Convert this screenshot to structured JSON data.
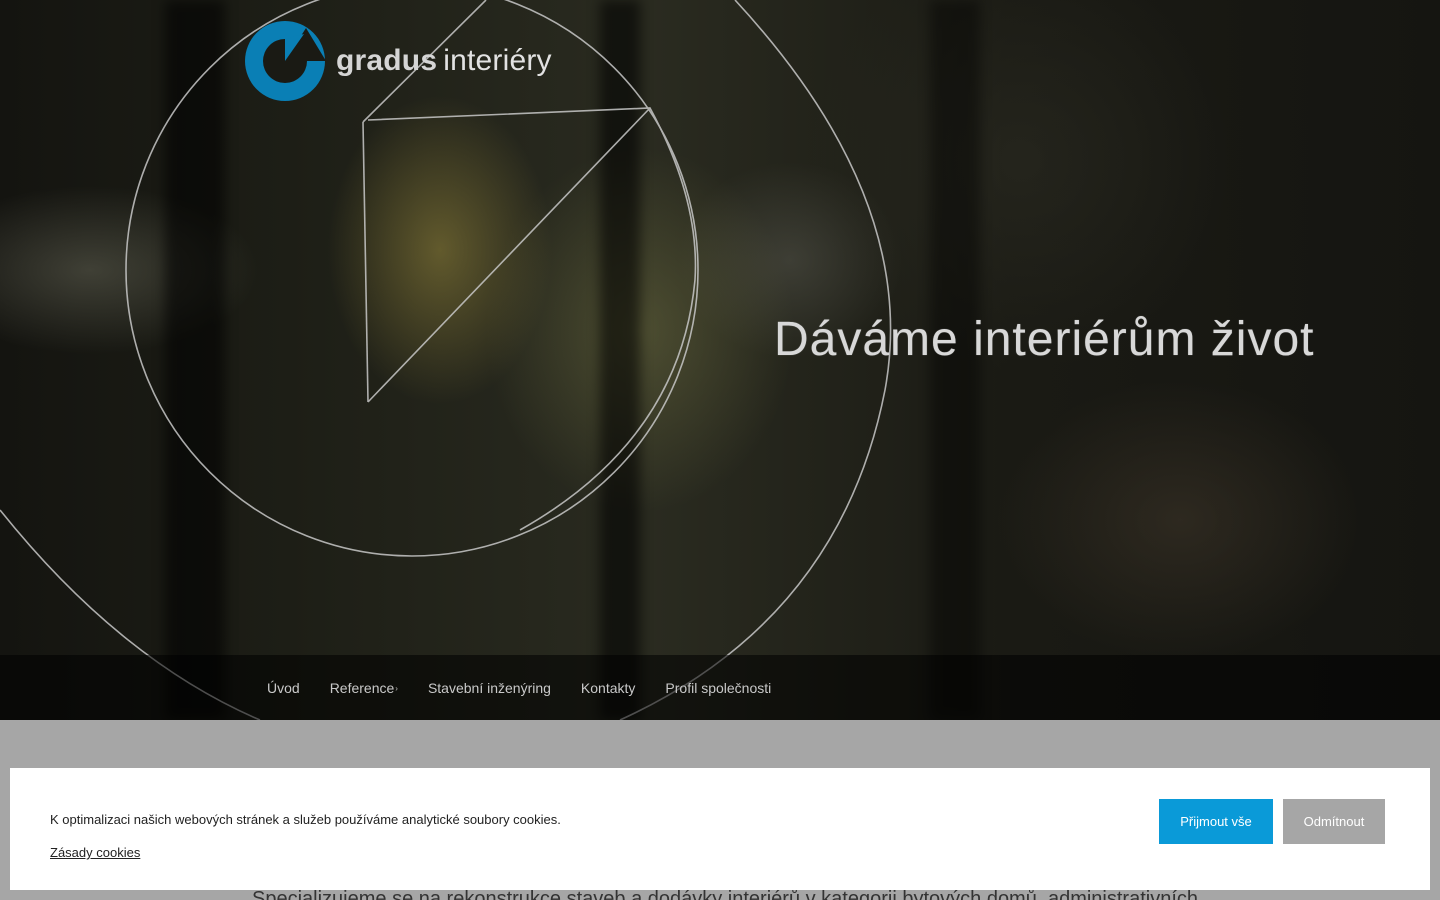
{
  "brand": {
    "name_bold": "gradus",
    "name_light": "interiéry",
    "mark_color": "#0a7fb5",
    "mark_icon": "gradus-logo-icon"
  },
  "hero": {
    "tagline": "Dáváme interiérům život"
  },
  "nav": {
    "items": [
      {
        "label": "Úvod",
        "has_submenu": false
      },
      {
        "label": "Reference",
        "has_submenu": true
      },
      {
        "label": "Stavební inženýring",
        "has_submenu": false
      },
      {
        "label": "Kontakty",
        "has_submenu": false
      },
      {
        "label": "Profil společnosti",
        "has_submenu": false
      }
    ],
    "submenu_glyph": "›"
  },
  "main": {
    "intro_partial": "Specializujeme se na rekonstrukce staveb a dodávky interiérů v kategorii bytových domů, administrativních"
  },
  "cookie_banner": {
    "message": "K optimalizaci našich webových stránek a služeb používáme analytické soubory cookies.",
    "policy_link": "Zásady cookies",
    "accept_label": "Přijmout vše",
    "decline_label": "Odmítnout",
    "accept_color": "#0a9ad8",
    "decline_color": "#a6a6a6"
  }
}
